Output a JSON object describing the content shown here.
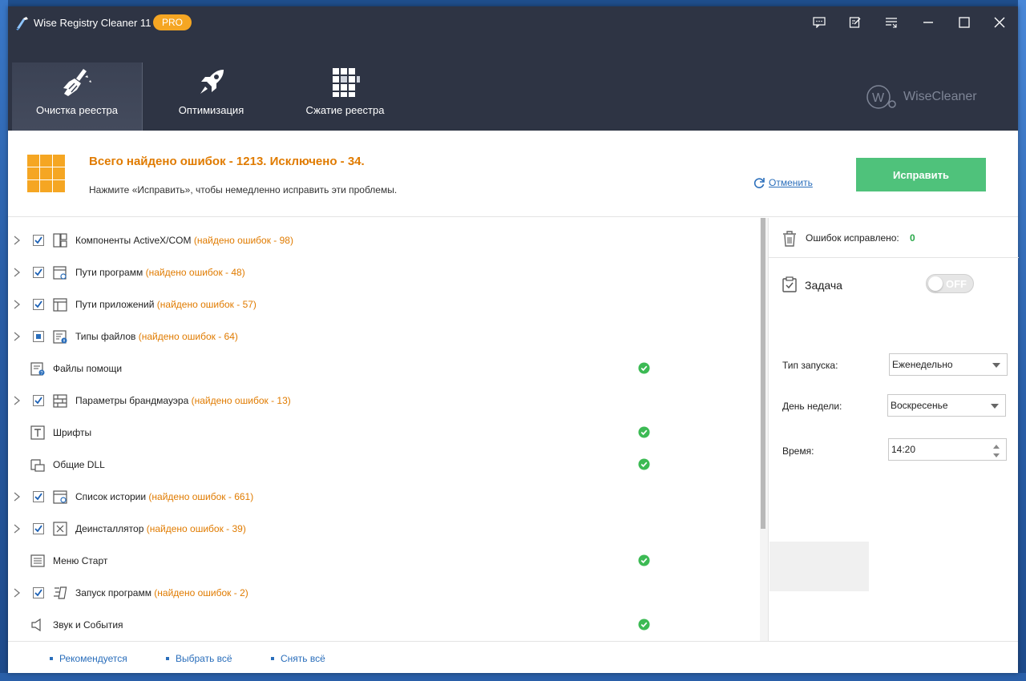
{
  "window": {
    "title": "Wise Registry Cleaner 11",
    "badge": "PRO"
  },
  "nav": {
    "tabs": [
      {
        "label": "Очистка реестра",
        "icon": "broom-icon",
        "active": true
      },
      {
        "label": "Оптимизация",
        "icon": "rocket-icon",
        "active": false
      },
      {
        "label": "Сжатие реестра",
        "icon": "grid-icon",
        "active": false
      }
    ]
  },
  "brand": {
    "text": "WiseCleaner"
  },
  "summary": {
    "title": "Всего найдено ошибок - 1213. Исключено - 34.",
    "subtitle": "Нажмите «Исправить», чтобы немедленно исправить эти проблемы.",
    "undo_label": "Отменить",
    "fix_label": "Исправить"
  },
  "items": [
    {
      "label": "Компоненты ActiveX/COM",
      "count": "(найдено ошибок - 98)",
      "state": "checked",
      "icon": "activex-icon"
    },
    {
      "label": "Пути программ",
      "count": "(найдено ошибок - 48)",
      "state": "checked",
      "icon": "program-path-icon"
    },
    {
      "label": "Пути приложений",
      "count": "(найдено ошибок - 57)",
      "state": "checked",
      "icon": "app-path-icon"
    },
    {
      "label": "Типы файлов",
      "count": "(найдено ошибок - 64)",
      "state": "partial",
      "icon": "file-types-icon"
    },
    {
      "label": "Файлы помощи",
      "count": "",
      "state": "ok",
      "icon": "help-files-icon"
    },
    {
      "label": "Параметры брандмауэра",
      "count": "(найдено ошибок - 13)",
      "state": "checked",
      "icon": "firewall-icon"
    },
    {
      "label": "Шрифты",
      "count": "",
      "state": "ok",
      "icon": "fonts-icon"
    },
    {
      "label": "Общие DLL",
      "count": "",
      "state": "ok",
      "icon": "dll-icon"
    },
    {
      "label": "Список истории",
      "count": "(найдено ошибок - 661)",
      "state": "checked",
      "icon": "history-icon"
    },
    {
      "label": "Деинсталлятор",
      "count": "(найдено ошибок - 39)",
      "state": "checked",
      "icon": "uninstaller-icon"
    },
    {
      "label": "Меню Старт",
      "count": "",
      "state": "ok",
      "icon": "start-menu-icon"
    },
    {
      "label": "Запуск программ",
      "count": "(найдено ошибок - 2)",
      "state": "checked",
      "icon": "startup-icon"
    },
    {
      "label": "Звук и События",
      "count": "",
      "state": "ok",
      "icon": "sound-icon"
    }
  ],
  "side": {
    "fixed_label": "Ошибок исправлено:",
    "fixed_count": "0",
    "task_label": "Задача",
    "toggle_label": "OFF",
    "run_type_label": "Тип запуска:",
    "run_type_value": "Еженедельно",
    "weekday_label": "День недели:",
    "weekday_value": "Воскресенье",
    "time_label": "Время:",
    "time_value": "14:20"
  },
  "footer": {
    "recommended": "Рекомендуется",
    "select_all": "Выбрать всё",
    "deselect_all": "Снять всё"
  },
  "colors": {
    "header_bg": "#2e3444",
    "accent_orange": "#e07b00",
    "fix_green": "#4fc27b",
    "link_blue": "#2a6ebb",
    "ok_green": "#3cba54"
  }
}
